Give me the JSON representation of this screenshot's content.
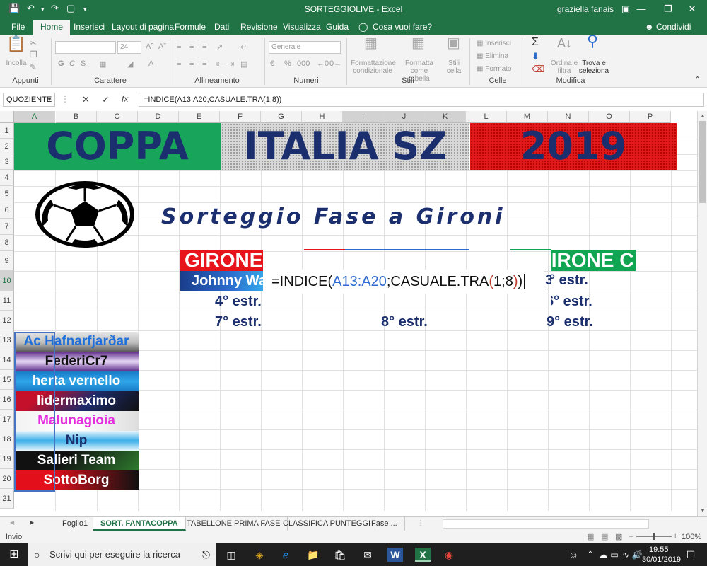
{
  "window": {
    "title": "SORTEGGIOLIVE  -  Excel",
    "user": "graziella fanais"
  },
  "tabs": [
    "File",
    "Home",
    "Inserisci",
    "Layout di pagina",
    "Formule",
    "Dati",
    "Revisione",
    "Visualizza",
    "Guida"
  ],
  "tell_me": "Cosa vuoi fare?",
  "share": "Condividi",
  "ribbon": {
    "groups": [
      "Appunti",
      "Carattere",
      "Allineamento",
      "Numeri",
      "Stili",
      "Celle",
      "Modifica"
    ],
    "paste": "Incolla",
    "font_size": "24",
    "number_format": "Generale",
    "cond_format": [
      "Formattazione",
      "condizionale"
    ],
    "format_table": [
      "Formatta come",
      "tabella"
    ],
    "cell_styles": [
      "Stili",
      "cella"
    ],
    "insert": "Inserisci",
    "delete": "Elimina",
    "format": "Formato",
    "sort": [
      "Ordina e",
      "filtra"
    ],
    "find": [
      "Trova e",
      "seleziona"
    ]
  },
  "formula_bar": {
    "name_box": "QUOZIENTE",
    "formula": "=INDICE(A13:A20;CASUALE.TRA(1;8))"
  },
  "columns": [
    "A",
    "B",
    "C",
    "D",
    "E",
    "F",
    "G",
    "H",
    "I",
    "J",
    "K",
    "L",
    "M",
    "N",
    "O",
    "P"
  ],
  "rows": [
    "1",
    "2",
    "3",
    "4",
    "5",
    "6",
    "7",
    "8",
    "9",
    "10",
    "11",
    "12",
    "13",
    "14",
    "15",
    "16",
    "17",
    "18",
    "19",
    "20",
    "21"
  ],
  "banner": {
    "left": "COPPA",
    "middle": "ITALIA SZ",
    "right": "2019"
  },
  "subtitle": "Sorteggio Fase a Gironi",
  "girone_a": "GIRONE A",
  "girone_c": "GIRONE C",
  "team_pick": "Johnny Walker",
  "formula_edit": {
    "prefix": "=INDICE(",
    "ref": "A13:A20",
    "mid": ";CASUALE.TRA",
    "open": "(",
    "args": "1;8",
    "close": ")",
    "end": ")"
  },
  "draws": {
    "c3": "3° estr.",
    "a4": "4° estr.",
    "c6": "6° estr.",
    "a7": "7° estr.",
    "b8": "8° estr.",
    "c9": "9° estr."
  },
  "teams": [
    "Ac Hafnarfjarðar",
    "FederiCr7",
    "herta vernello",
    "lìdermaximo",
    "Malunagioia",
    "Nip",
    "Salieri Team",
    "SottoBorg"
  ],
  "sheet_tabs": [
    "Foglio1",
    "SORT. FANTACOPPA",
    "TABELLONE PRIMA FASE",
    "CLASSIFICA PUNTEGGI",
    "Fase ..."
  ],
  "status": {
    "mode": "Invio",
    "zoom": "100%"
  },
  "taskbar": {
    "search": "Scrivi qui per eseguire la ricerca",
    "time": "19:55",
    "date": "30/01/2019"
  }
}
